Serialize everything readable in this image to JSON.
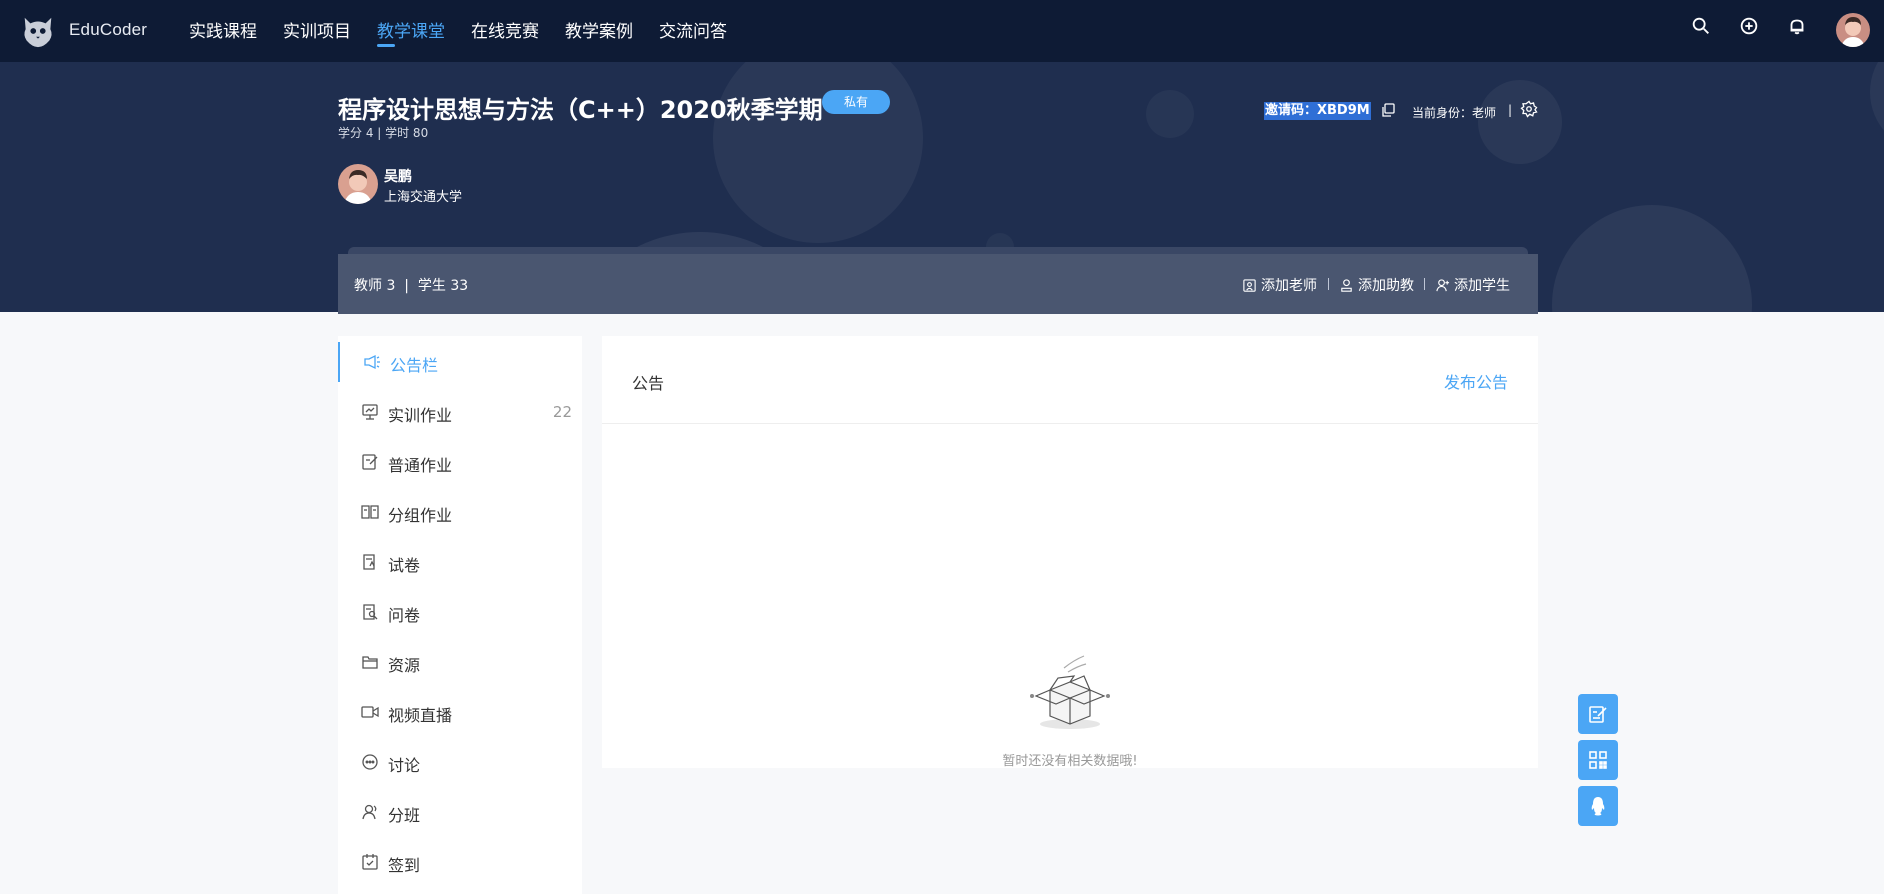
{
  "brand": {
    "name": "EduCoder"
  },
  "nav": {
    "items": [
      "实践课程",
      "实训项目",
      "教学课堂",
      "在线竞赛",
      "教学案例",
      "交流问答"
    ],
    "active": "教学课堂"
  },
  "course": {
    "title": "程序设计思想与方法（C++）2020秋季学期",
    "badge": "私有",
    "meta": "学分 4 | 学时 80",
    "teacher_name": "吴鹏",
    "teacher_org": "上海交通大学",
    "invite_code": "邀请码：XBD9M",
    "identity": "当前身份：老师",
    "separator": "|"
  },
  "stats": {
    "summary": "教师 3  |  学生 33",
    "actions": [
      "添加老师",
      "添加助教",
      "添加学生"
    ]
  },
  "sidebar": {
    "items": [
      {
        "label": "公告栏",
        "icon": "megaphone-icon",
        "active": true,
        "count": ""
      },
      {
        "label": "实训作业",
        "icon": "training-homework-icon",
        "count": "22"
      },
      {
        "label": "普通作业",
        "icon": "edit-document-icon",
        "count": ""
      },
      {
        "label": "分组作业",
        "icon": "book-icon",
        "count": ""
      },
      {
        "label": "试卷",
        "icon": "exam-paper-icon",
        "count": ""
      },
      {
        "label": "问卷",
        "icon": "questionnaire-icon",
        "count": ""
      },
      {
        "label": "资源",
        "icon": "folder-icon",
        "count": ""
      },
      {
        "label": "视频直播",
        "icon": "video-camera-icon",
        "count": ""
      },
      {
        "label": "讨论",
        "icon": "chat-bubble-icon",
        "count": ""
      },
      {
        "label": "分班",
        "icon": "users-icon",
        "count": ""
      },
      {
        "label": "签到",
        "icon": "calendar-check-icon",
        "count": ""
      }
    ]
  },
  "main": {
    "title": "公告",
    "publish_label": "发布公告",
    "empty_text": "暂时还没有相关数据哦!"
  },
  "colors": {
    "nav_bg": "#0e1b35",
    "banner_bg": "#1f2e4f",
    "accent": "#4ba6f5",
    "stats_bar": "#4a5670"
  }
}
